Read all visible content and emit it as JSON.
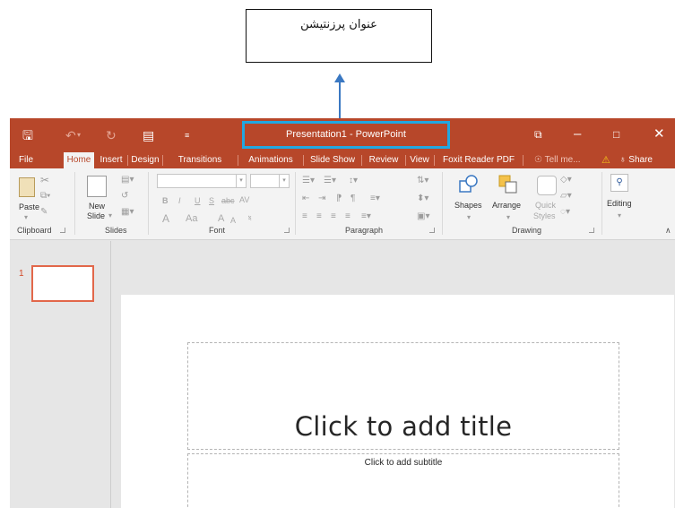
{
  "annotation": {
    "label": "عنوان پرزنتیشن"
  },
  "titlebar": {
    "title": "Presentation1 - PowerPoint",
    "icons": [
      "save-icon",
      "undo-icon",
      "redo-icon",
      "start-from-beginning-icon",
      "customize-qat-icon",
      "ribbon-display-options-icon",
      "minimize-icon",
      "maximize-icon",
      "close-icon"
    ]
  },
  "tabs": {
    "file": "File",
    "home": "Home",
    "insert": "Insert",
    "design": "Design",
    "transitions": "Transitions",
    "animations": "Animations",
    "slideshow": "Slide Show",
    "review": "Review",
    "view": "View",
    "foxit": "Foxit Reader PDF",
    "tell": "Tell me...",
    "share": "Share"
  },
  "ribbon": {
    "clipboard": {
      "paste": "Paste",
      "label": "Clipboard"
    },
    "slides": {
      "new_slide_1": "New",
      "new_slide_2": "Slide",
      "label": "Slides"
    },
    "font": {
      "bold": "B",
      "italic": "I",
      "underline": "U",
      "shadow": "S",
      "strike": "abc",
      "spacing": "AV",
      "font_color": "A",
      "change_case": "Aa",
      "grow": "A",
      "shrink": "A",
      "label": "Font"
    },
    "paragraph": {
      "label": "Paragraph"
    },
    "drawing": {
      "shapes": "Shapes",
      "arrange": "Arrange",
      "quick_1": "Quick",
      "quick_2": "Styles",
      "label": "Drawing"
    },
    "editing": {
      "label": "Editing"
    }
  },
  "slides_panel": {
    "slide_number": "1"
  },
  "slide": {
    "title_placeholder": "Click to add title",
    "subtitle_placeholder": "Click to add subtitle"
  },
  "colors": {
    "accent": "#b7472a",
    "highlight": "#22a7e0",
    "arrow": "#3a78c2"
  }
}
